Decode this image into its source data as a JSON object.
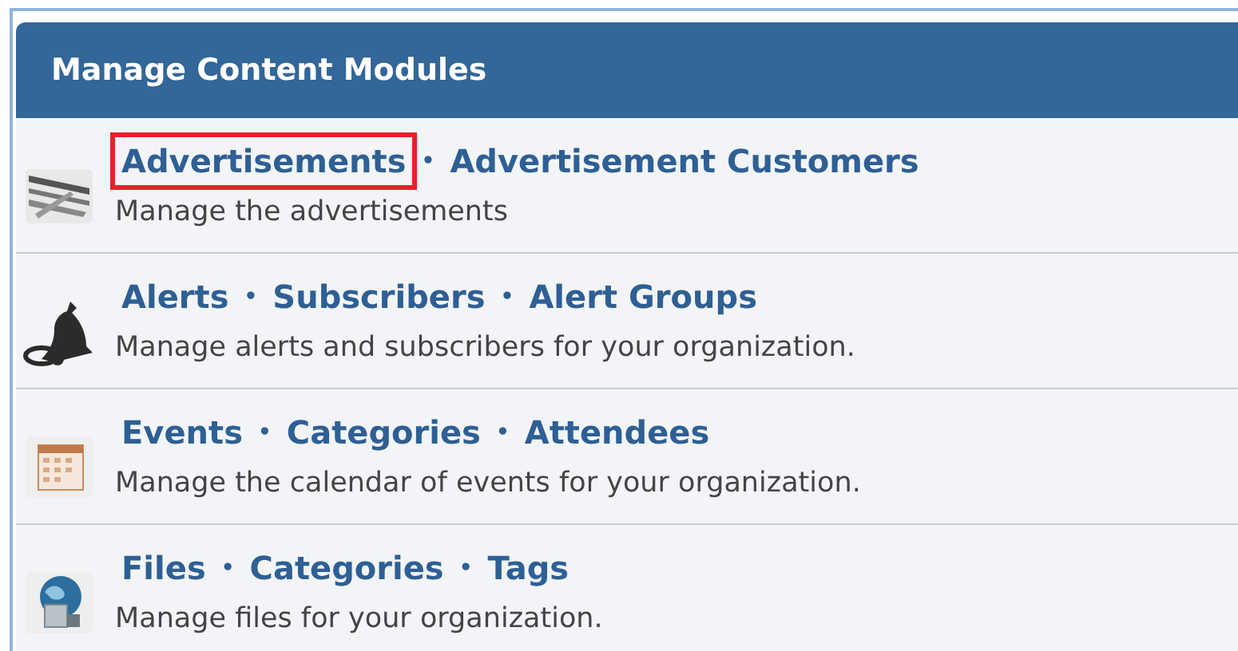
{
  "panel": {
    "title": "Manage Content Modules"
  },
  "modules": [
    {
      "items": [
        {
          "kind": "link",
          "label": "Advertisements",
          "highlighted": true
        },
        {
          "kind": "separator",
          "label": "•"
        },
        {
          "kind": "link",
          "label": "Advertisement Customers",
          "highlighted": false
        }
      ],
      "description": "Manage the advertisements"
    },
    {
      "items": [
        {
          "kind": "link",
          "label": "Alerts",
          "highlighted": false
        },
        {
          "kind": "separator",
          "label": "•"
        },
        {
          "kind": "link",
          "label": "Subscribers",
          "highlighted": false
        },
        {
          "kind": "separator",
          "label": "•"
        },
        {
          "kind": "link",
          "label": "Alert Groups",
          "highlighted": false
        }
      ],
      "description": "Manage alerts and subscribers for your organization."
    },
    {
      "items": [
        {
          "kind": "link",
          "label": "Events",
          "highlighted": false
        },
        {
          "kind": "separator",
          "label": "•"
        },
        {
          "kind": "link",
          "label": "Categories",
          "highlighted": false
        },
        {
          "kind": "separator",
          "label": "•"
        },
        {
          "kind": "link",
          "label": "Attendees",
          "highlighted": false
        }
      ],
      "description": "Manage the calendar of events for your organization."
    },
    {
      "items": [
        {
          "kind": "link",
          "label": "Files",
          "highlighted": false
        },
        {
          "kind": "separator",
          "label": "•"
        },
        {
          "kind": "link",
          "label": "Categories",
          "highlighted": false
        },
        {
          "kind": "separator",
          "label": "•"
        },
        {
          "kind": "link",
          "label": "Tags",
          "highlighted": false
        }
      ],
      "description": "Manage files for your organization."
    }
  ]
}
